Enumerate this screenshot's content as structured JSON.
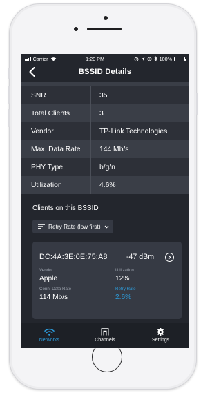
{
  "status_bar": {
    "carrier": "Carrier",
    "time": "1:20 PM",
    "battery": "100%"
  },
  "nav": {
    "title": "BSSID Details"
  },
  "details": [
    {
      "key": "SNR",
      "value": "35"
    },
    {
      "key": "Total Clients",
      "value": "3"
    },
    {
      "key": "Vendor",
      "value": "TP-Link Technologies"
    },
    {
      "key": "Max. Data Rate",
      "value": "144 Mb/s"
    },
    {
      "key": "PHY Type",
      "value": "b/g/n"
    },
    {
      "key": "Utilization",
      "value": "4.6%"
    }
  ],
  "clients_section": {
    "title": "Clients on this BSSID",
    "sort_label": "Retry Rate (low first)"
  },
  "client": {
    "mac": "DC:4A:3E:0E:75:A8",
    "signal": "-47 dBm",
    "vendor_label": "Vendor",
    "vendor": "Apple",
    "utilization_label": "Utilization",
    "utilization": "12%",
    "rate_label": "Conn. Data Rate",
    "rate": "114 Mb/s",
    "retry_label": "Retry Rate",
    "retry": "2.6%"
  },
  "tabs": [
    {
      "label": "Networks",
      "icon": "wifi-icon",
      "active": true
    },
    {
      "label": "Channels",
      "icon": "channels-icon",
      "active": false
    },
    {
      "label": "Settings",
      "icon": "gear-icon",
      "active": false
    }
  ],
  "colors": {
    "background": "#23262d",
    "accent": "#2d9cdb",
    "row_dark": "#2d3038",
    "row_light": "#3a3e47",
    "card": "#363a44"
  }
}
